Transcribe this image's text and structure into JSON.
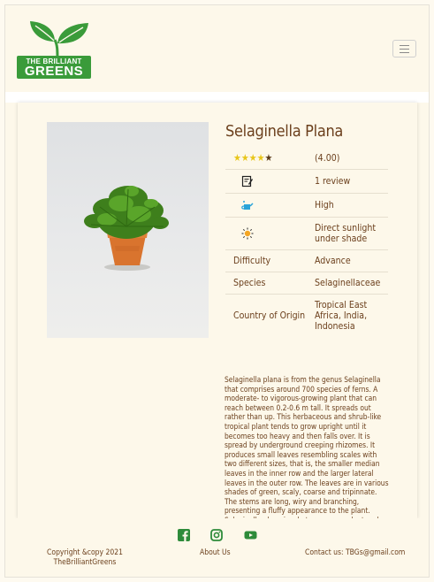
{
  "brand": {
    "logo_line1": "THE BRILLIANT",
    "logo_line2": "GREENS",
    "colors": {
      "green": "#3a9b3a",
      "brown": "#6b3f1c",
      "cream": "#fdf8ea",
      "star": "#e8c61a"
    }
  },
  "header": {
    "menu_icon": "hamburger-icon"
  },
  "product": {
    "name": "Selaginella Plana",
    "rating": {
      "stars_filled": 4,
      "stars_total": 5,
      "value_text": "(4.00)"
    },
    "reviews": {
      "icon": "review-icon",
      "text": "1 review"
    },
    "water": {
      "icon": "watering-can-icon",
      "text": "High"
    },
    "light": {
      "icon": "sun-icon",
      "text": "Direct sunlight under shade"
    },
    "attributes": [
      {
        "label": "Difficulty",
        "value": "Advance"
      },
      {
        "label": "Species",
        "value": "Selaginellaceae"
      },
      {
        "label": "Country of Origin",
        "value": "Tropical East Africa, India, Indonesia"
      }
    ],
    "description": "Selaginella plana is from the genus Selaginella that comprises around 700 species of ferns. A moderate- to vigorous-growing plant that can reach between 0.2-0.6 m tall. It spreads out rather than up. This herbaceous and shrub-like tropical plant tends to grow upright until it becomes too heavy and then falls over. It is spread by underground creeping rhizomes. It produces small leaves resembling scales with two different sizes, that is, the smaller median leaves in the inner row and the larger lateral leaves in the outer row. The leaves are in various shades of green, scaly, coarse and tripinnate. The stems are long, wiry and branching, presenting a fluffy appearance to the plant. Selaginella plana is a heterosporous plant and reproduces sexually. It has distinct male and female spores known as microspores and megaspores."
  },
  "footer": {
    "social": [
      "facebook-icon",
      "instagram-icon",
      "youtube-icon"
    ],
    "copyright": "Copyright &copy 2021 TheBrilliantGreens",
    "about": "About Us",
    "contact": "Contact us: TBGs@gmail.com"
  }
}
